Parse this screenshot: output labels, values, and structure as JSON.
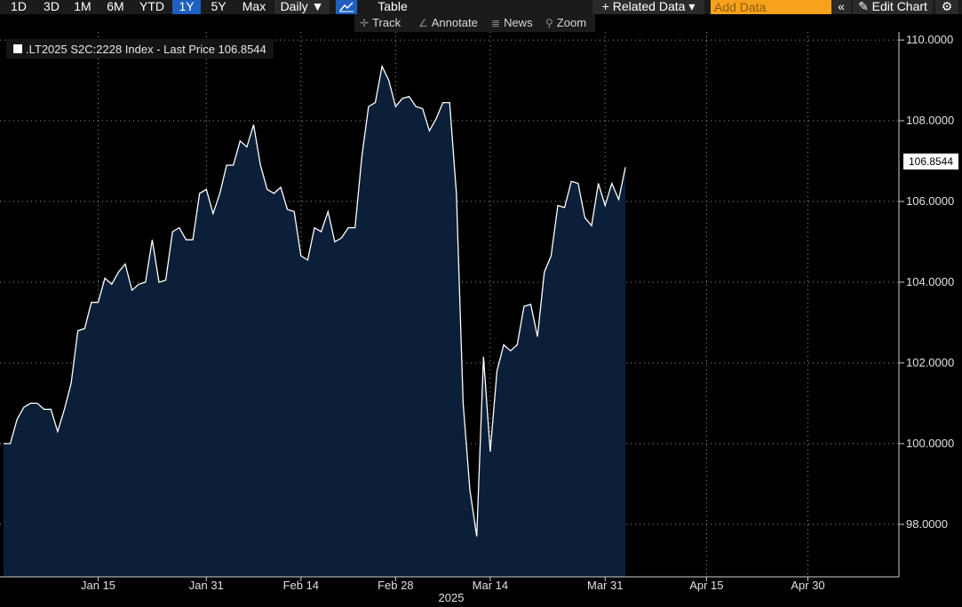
{
  "toolbar": {
    "ranges": [
      "1D",
      "3D",
      "1M",
      "6M",
      "YTD",
      "1Y",
      "5Y",
      "Max"
    ],
    "active_range": "1Y",
    "frequency": "Daily ▼",
    "table_label": "Table",
    "related_data": "+ Related Data ▾",
    "add_data_placeholder": "Add Data",
    "collapse": "«",
    "edit_chart": "✎ Edit Chart",
    "settings": "⚙"
  },
  "toolbar2": {
    "track": "Track",
    "annotate": "Annotate",
    "news": "News",
    "zoom": "Zoom"
  },
  "legend": {
    "text": ".LT2025 S2C:2228 Index - Last Price 106.8544"
  },
  "last_price_label": "106.8544",
  "colors": {
    "background": "#000000",
    "area_fill": "#0b1f38",
    "line": "#ffffff",
    "active_tab": "#1f5fbf",
    "add_data": "#f7a21d"
  },
  "chart_data": {
    "type": "area",
    "title": "",
    "series": [
      {
        "name": ".LT2025 S2C:2228 Index - Last Price",
        "dates": [
          "2025-01-01",
          "2025-01-02",
          "2025-01-03",
          "2025-01-04",
          "2025-01-05",
          "2025-01-06",
          "2025-01-07",
          "2025-01-08",
          "2025-01-09",
          "2025-01-10",
          "2025-01-11",
          "2025-01-12",
          "2025-01-13",
          "2025-01-14",
          "2025-01-15",
          "2025-01-16",
          "2025-01-17",
          "2025-01-18",
          "2025-01-19",
          "2025-01-20",
          "2025-01-21",
          "2025-01-22",
          "2025-01-23",
          "2025-01-24",
          "2025-01-25",
          "2025-01-26",
          "2025-01-27",
          "2025-01-28",
          "2025-01-29",
          "2025-01-30",
          "2025-01-31",
          "2025-02-01",
          "2025-02-02",
          "2025-02-03",
          "2025-02-04",
          "2025-02-05",
          "2025-02-06",
          "2025-02-07",
          "2025-02-08",
          "2025-02-09",
          "2025-02-10",
          "2025-02-11",
          "2025-02-12",
          "2025-02-13",
          "2025-02-14",
          "2025-02-15",
          "2025-02-16",
          "2025-02-17",
          "2025-02-18",
          "2025-02-19",
          "2025-02-20",
          "2025-02-21",
          "2025-02-22",
          "2025-02-23",
          "2025-02-24",
          "2025-02-25",
          "2025-02-26",
          "2025-02-27",
          "2025-02-28",
          "2025-03-01",
          "2025-03-02",
          "2025-03-03",
          "2025-03-04",
          "2025-03-05",
          "2025-03-06",
          "2025-03-07",
          "2025-03-08",
          "2025-03-09",
          "2025-03-10",
          "2025-03-11",
          "2025-03-12",
          "2025-03-13",
          "2025-03-14",
          "2025-03-15",
          "2025-03-16",
          "2025-03-17",
          "2025-03-18",
          "2025-03-19",
          "2025-03-20",
          "2025-03-21",
          "2025-03-22",
          "2025-03-23",
          "2025-03-24",
          "2025-03-25",
          "2025-03-26",
          "2025-03-27",
          "2025-03-28",
          "2025-03-29",
          "2025-03-30",
          "2025-03-31",
          "2025-04-01",
          "2025-04-02",
          "2025-04-03",
          "2025-04-04",
          "2025-04-05",
          "2025-04-06",
          "2025-04-07",
          "2025-04-08",
          "2025-04-09",
          "2025-04-10",
          "2025-04-11",
          "2025-04-12",
          "2025-04-13",
          "2025-04-14",
          "2025-04-15",
          "2025-04-16",
          "2025-04-17",
          "2025-04-18",
          "2025-04-19",
          "2025-04-20",
          "2025-04-21",
          "2025-04-22",
          "2025-04-23",
          "2025-04-24",
          "2025-04-25",
          "2025-04-26",
          "2025-04-27",
          "2025-04-28",
          "2025-04-29",
          "2025-04-30",
          "2025-05-01",
          "2025-05-02",
          "2025-05-03",
          "2025-05-04",
          "2025-05-05",
          "2025-05-06",
          "2025-05-07",
          "2025-05-08",
          "2025-05-09"
        ],
        "values": [
          100.0,
          100.0,
          100.6,
          100.9,
          101.0,
          101.0,
          100.85,
          100.85,
          100.3,
          100.85,
          101.5,
          102.8,
          102.85,
          103.5,
          103.5,
          104.1,
          103.95,
          104.25,
          104.45,
          103.8,
          103.95,
          104.0,
          105.05,
          104.0,
          104.05,
          105.25,
          105.35,
          105.05,
          105.05,
          106.2,
          106.3,
          105.7,
          106.2,
          106.9,
          106.9,
          107.5,
          107.35,
          107.9,
          106.9,
          106.3,
          106.2,
          106.35,
          105.8,
          105.75,
          104.65,
          104.55,
          105.35,
          105.25,
          105.75,
          105.0,
          105.1,
          105.35,
          105.35,
          107.1,
          108.35,
          108.45,
          109.35,
          109.0,
          108.35,
          108.55,
          108.6,
          108.35,
          108.3,
          107.75,
          108.05,
          108.45,
          108.45,
          106.2,
          101.0,
          98.85,
          97.7,
          102.15,
          99.8,
          101.8,
          102.45,
          102.3,
          102.45,
          103.4,
          103.45,
          102.65,
          104.25,
          104.65,
          105.9,
          105.85,
          106.5,
          106.45,
          105.6,
          105.4,
          106.45,
          105.9,
          106.45,
          106.05,
          106.85
        ]
      }
    ],
    "x_tick_labels": [
      "Jan 15",
      "Jan 31",
      "Feb 14",
      "Feb 28",
      "Mar 14",
      "Mar 31",
      "Apr 15",
      "Apr 30"
    ],
    "x_tick_dates": [
      "2025-01-15",
      "2025-01-31",
      "2025-02-14",
      "2025-02-28",
      "2025-03-14",
      "2025-03-31",
      "2025-04-15",
      "2025-04-30"
    ],
    "x_year_label": "2025",
    "y_ticks": [
      98.0,
      100.0,
      102.0,
      104.0,
      106.0,
      108.0,
      110.0
    ],
    "y_tick_labels": [
      "98.0000",
      "100.0000",
      "102.0000",
      "104.0000",
      "106.0000",
      "108.0000",
      "110.0000"
    ],
    "ylim": [
      96.7,
      110.2
    ],
    "last_price": 106.8544,
    "grid": true,
    "legend_position": "top-left",
    "y_axis_side": "right"
  }
}
